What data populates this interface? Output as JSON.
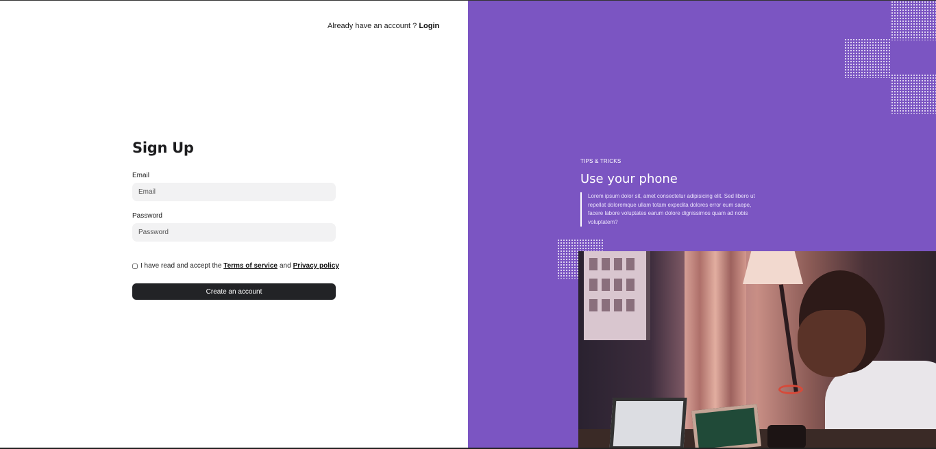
{
  "header": {
    "account_prompt": "Already have an account ?",
    "login_link": "Login"
  },
  "signup": {
    "title": "Sign Up",
    "email_label": "Email",
    "email_placeholder": "Email",
    "email_value": "",
    "password_label": "Password",
    "password_placeholder": "Password",
    "password_value": "",
    "agree_prefix": "I have read and accept the",
    "terms_link": "Terms of service",
    "agree_and": "and",
    "privacy_link": "Privacy policy",
    "agree_checked": false,
    "submit_label": "Create an account"
  },
  "promo": {
    "tag": "TIPS & TRICKS",
    "title": "Use your phone",
    "body": "Lorem ipsum dolor sit, amet consectetur adipisicing elit. Sed libero ut repellat doloremque ullam totam expedita dolores error eum saepe, facere labore voluptates earum dolore dignissimos quam ad nobis voluptatem?",
    "image_subject": "man working on laptop and tablet at desk"
  },
  "colors": {
    "panel_bg": "#7b55c2",
    "button_bg": "#222326",
    "input_bg": "#f2f2f3"
  }
}
